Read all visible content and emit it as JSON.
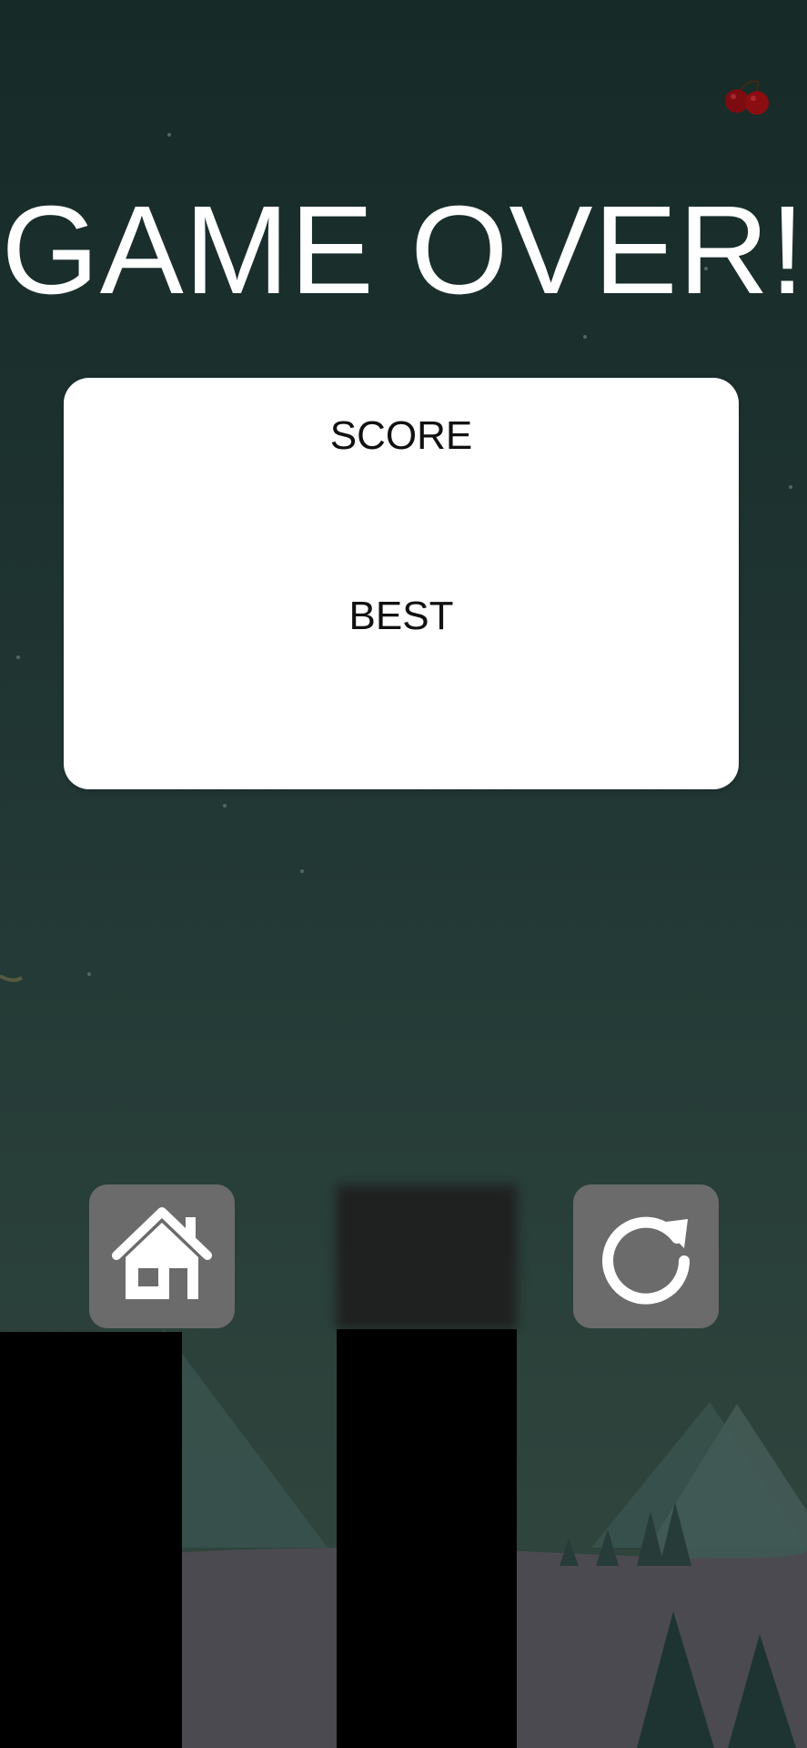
{
  "game": {
    "title": "GAME OVER!",
    "score_label": "SCORE",
    "score_value": "",
    "best_label": "BEST",
    "best_value": ""
  },
  "buttons": {
    "home_icon": "home-icon",
    "restart_icon": "restart-icon"
  },
  "hud": {
    "cherry_icon": "cherry-icon"
  },
  "colors": {
    "background_top": "#162a28",
    "background_bottom": "#2e4841",
    "card": "#ffffff",
    "button": "#6b6b6b",
    "pillar": "#000000",
    "title": "#ffffff",
    "cherry": "#8b0d12"
  }
}
